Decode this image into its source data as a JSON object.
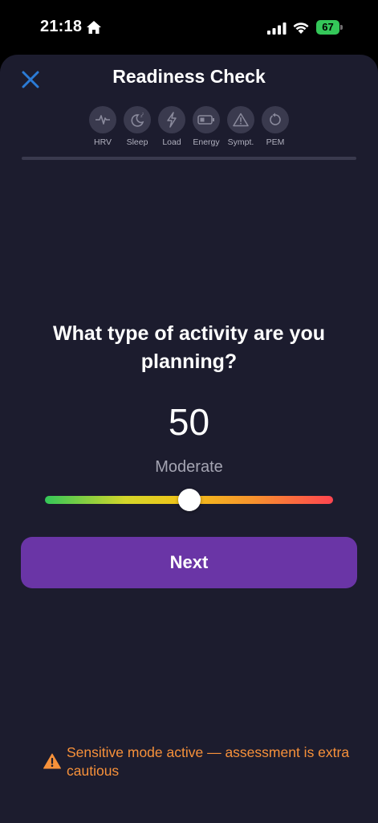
{
  "status_bar": {
    "time": "21:18",
    "battery": "67"
  },
  "header": {
    "title": "Readiness Check"
  },
  "steps": [
    {
      "label": "HRV",
      "icon": "heartbeat-icon"
    },
    {
      "label": "Sleep",
      "icon": "moon-icon"
    },
    {
      "label": "Load",
      "icon": "lightning-icon"
    },
    {
      "label": "Energy",
      "icon": "battery-icon"
    },
    {
      "label": "Sympt.",
      "icon": "warning-icon"
    },
    {
      "label": "PEM",
      "icon": "refresh-icon"
    }
  ],
  "main": {
    "question": "What type of activity are you planning?",
    "value": "50",
    "value_label": "Moderate",
    "slider_fraction": 0.5,
    "next_label": "Next"
  },
  "notice": {
    "text": "Sensitive mode active — assessment is extra cautious"
  },
  "colors": {
    "background": "#1c1c2e",
    "accent": "#6a35a6",
    "close": "#2b7bd6",
    "warning": "#f7913a"
  }
}
